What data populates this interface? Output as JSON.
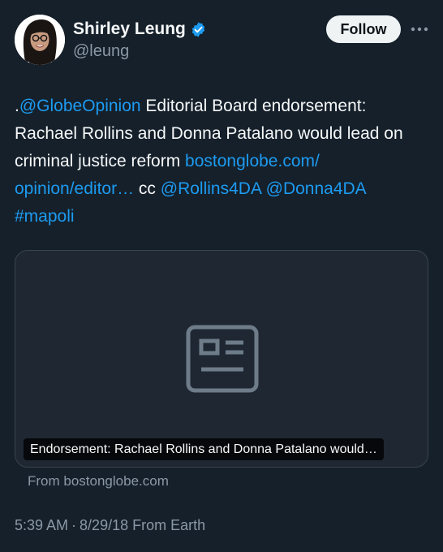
{
  "author": {
    "name": "Shirley Leung",
    "handle": "@leung",
    "verified_color": "#1d9bf0",
    "avatar_icon": "profile-photo"
  },
  "actions": {
    "follow_label": "Follow",
    "more_icon": "more-horizontal-icon"
  },
  "tweet": {
    "prefix": ".",
    "mention_globe": "@GlobeOpinion",
    "text_main": " Editorial Board endorsement: Rachael Rollins and Donna Patalano would lead on criminal justice reform ",
    "link_url_text": "bostonglobe.com/ opinion/editor…",
    "cc": " cc ",
    "mention_rollins": "@Rollins4DA",
    "space": " ",
    "mention_donna": "@Donna4DA",
    "hashtag": "#mapoli"
  },
  "card": {
    "icon": "article-icon",
    "title": "Endorsement: Rachael Rollins and Donna Patalano would…",
    "source": "From bostonglobe.com"
  },
  "meta": {
    "time": "5:39 AM",
    "separator": "·",
    "date": "8/29/18",
    "location": "From Earth"
  },
  "colors": {
    "background": "#15202b",
    "link": "#1d9bf0",
    "muted": "#8b98a5",
    "card_bg": "#1e2732",
    "border": "#38444d"
  }
}
